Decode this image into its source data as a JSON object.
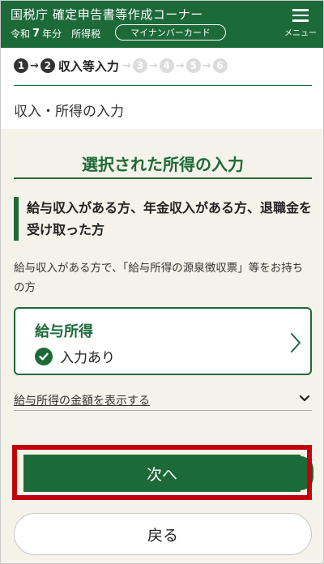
{
  "header": {
    "title": "国税庁 確定申告書等作成コーナー",
    "era": "令和",
    "year": "7",
    "year_suffix": "年分",
    "tax_type": "所得税",
    "mynumber_card_label": "マイナンバーカード",
    "menu_label": "メニュー"
  },
  "steps": {
    "current_label": "収入等入力",
    "items": [
      "1",
      "2",
      "3",
      "4",
      "5",
      "6"
    ]
  },
  "page_heading": "収入・所得の入力",
  "section_title": "選択された所得の入力",
  "subhead": "給与収入がある方、年金収入がある方、退職金を受け取った方",
  "description": "給与収入がある方で、「給与所得の源泉徴収票」等をお持ちの方",
  "card": {
    "title": "給与所得",
    "status": "入力あり"
  },
  "toggle": {
    "label": "給与所得の金額を表示する"
  },
  "buttons": {
    "next": "次へ",
    "back": "戻る"
  },
  "colors": {
    "brand_green": "#1d6a39",
    "highlight_red": "#c4000b",
    "background": "#f5f2e9"
  }
}
